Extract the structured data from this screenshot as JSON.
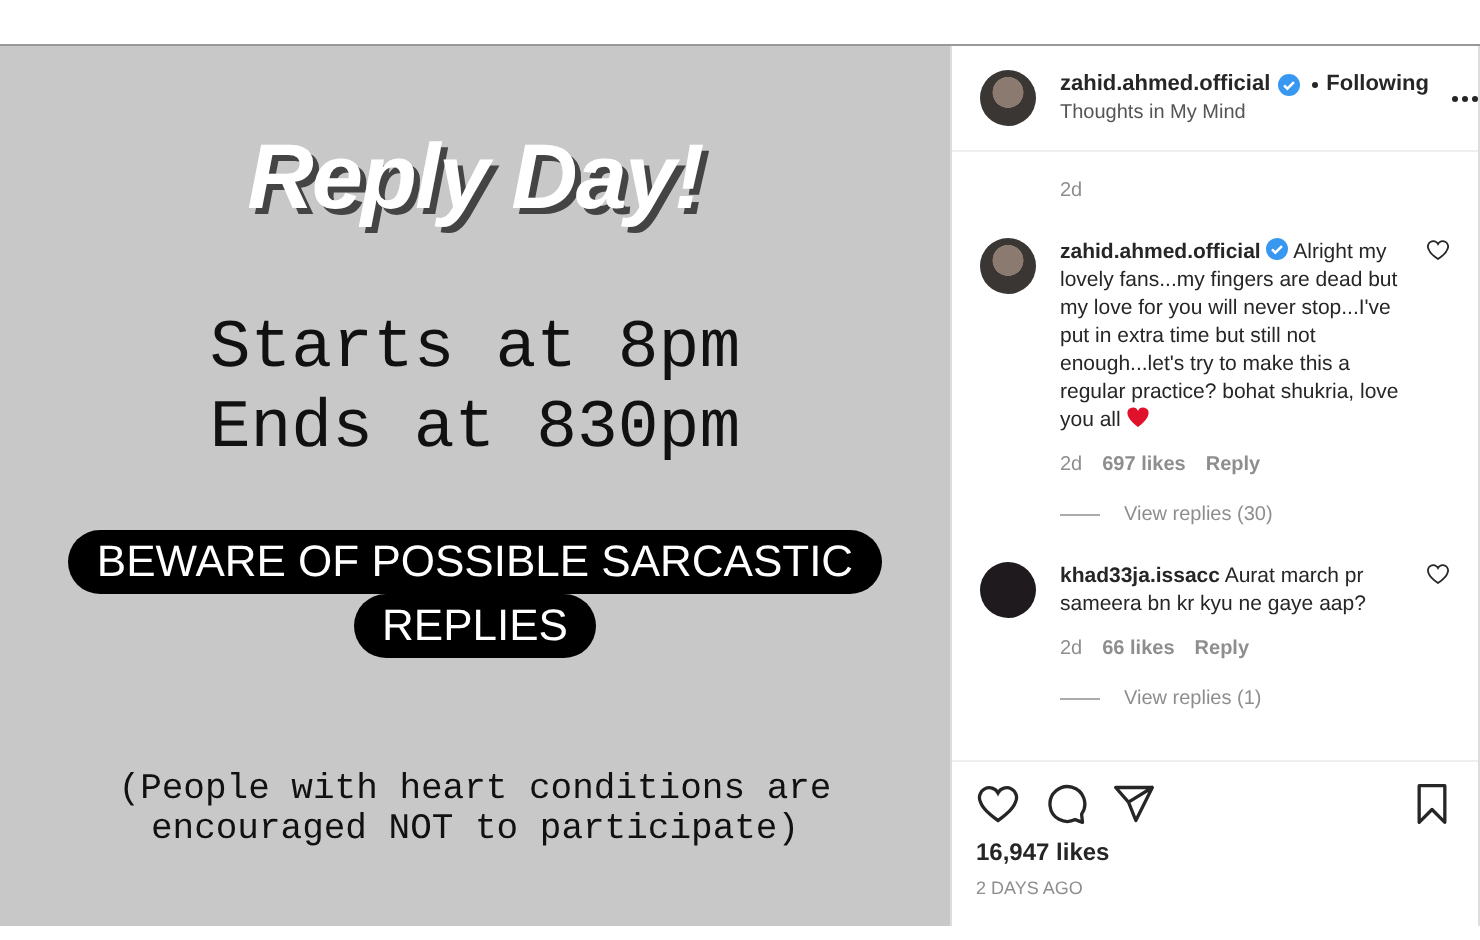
{
  "post": {
    "title": "Reply Day!",
    "schedule": [
      "Starts at 8pm",
      "Ends at 830pm"
    ],
    "warning_lines": [
      "BEWARE OF POSSIBLE SARCASTIC",
      "REPLIES"
    ],
    "note": [
      "(People with heart conditions are",
      "encouraged NOT to participate)"
    ]
  },
  "header": {
    "username": "zahid.ahmed.official",
    "verified": true,
    "follow_status": "Following",
    "subtitle": "Thoughts in My Mind"
  },
  "earlier_time": "2d",
  "comments": [
    {
      "username": "zahid.ahmed.official",
      "verified": true,
      "text": "Alright my lovely fans...my fingers are dead but my love for you will never stop...I've put in extra time but still not enough...let's try to make this a regular practice? bohat shukria, love you all",
      "heart_emoji": true,
      "time": "2d",
      "likes": "697 likes",
      "reply": "Reply",
      "view_replies": "View replies (30)",
      "liked": false
    },
    {
      "username": "khad33ja.issacc",
      "verified": false,
      "text": "Aurat march pr sameera bn kr kyu ne gaye aap?",
      "heart_emoji": false,
      "time": "2d",
      "likes": "66 likes",
      "reply": "Reply",
      "view_replies": "View replies (1)",
      "liked": false
    }
  ],
  "actions": {
    "liked": false,
    "saved": false
  },
  "likes": "16,947 likes",
  "date": "2 DAYS AGO"
}
